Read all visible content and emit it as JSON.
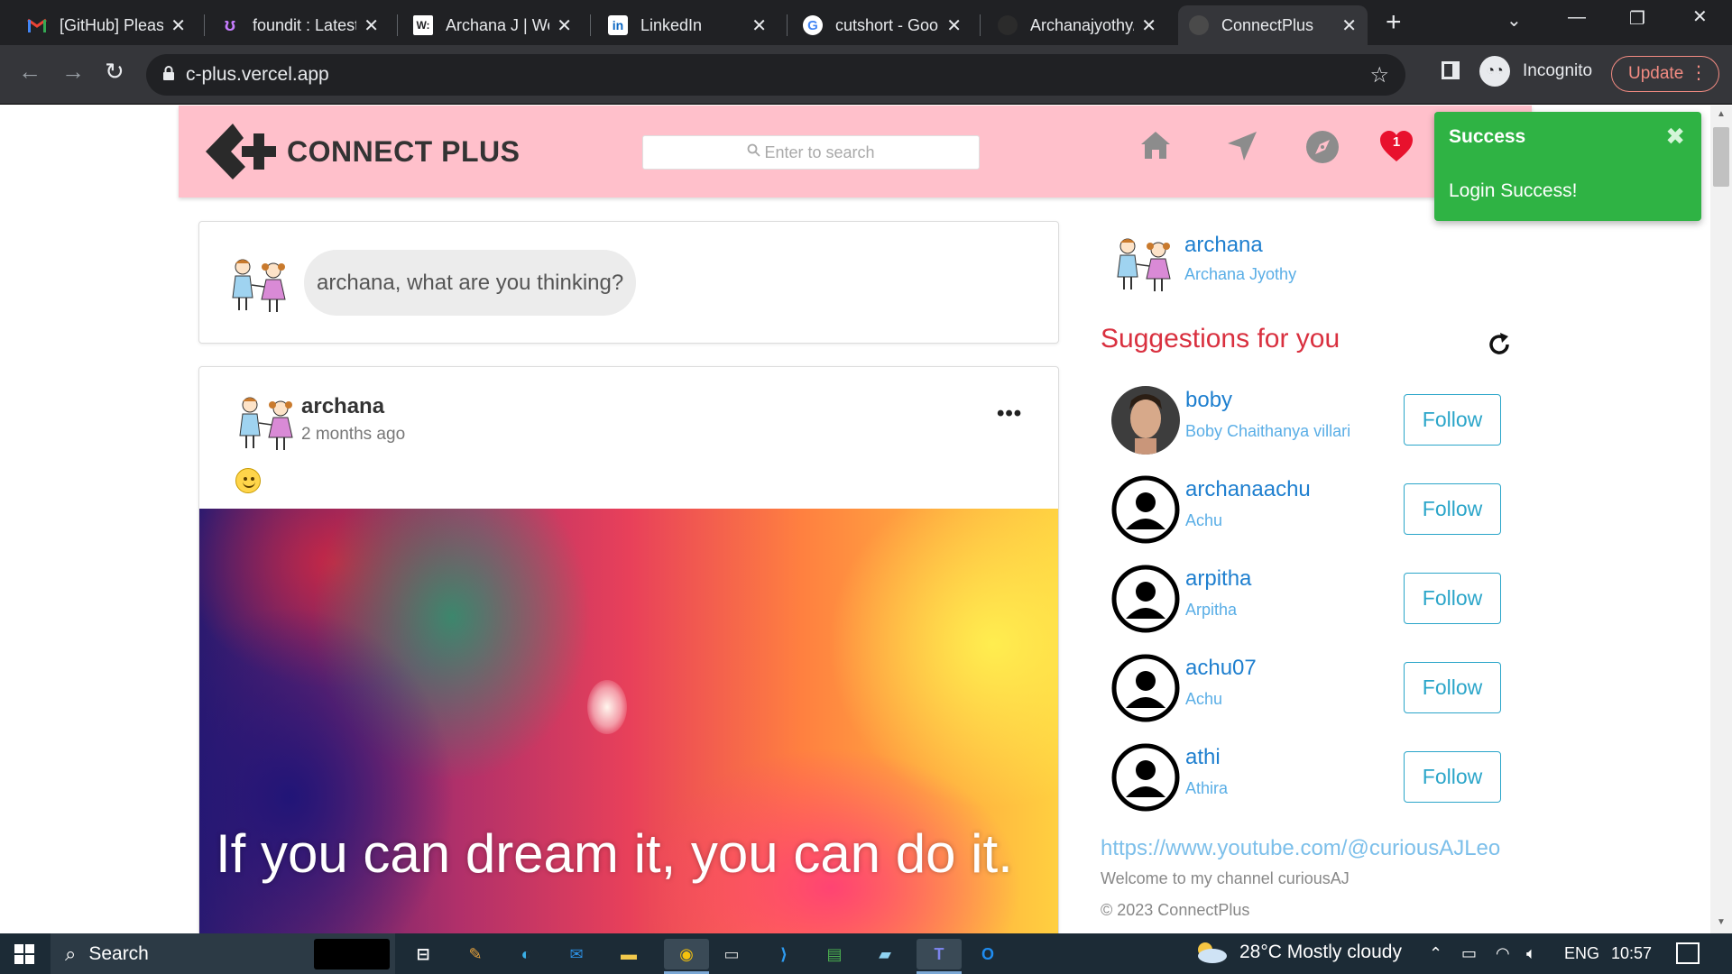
{
  "browser": {
    "tabs": [
      {
        "title": "[GitHub] Please",
        "icon": "gmail-icon",
        "close": "✕"
      },
      {
        "title": "foundit : Latest",
        "icon": "foundit-icon",
        "close": "✕"
      },
      {
        "title": "Archana J | We",
        "icon": "w-icon",
        "close": "✕"
      },
      {
        "title": "LinkedIn",
        "icon": "linkedin-icon",
        "close": "✕"
      },
      {
        "title": "cutshort - Goo",
        "icon": "google-icon",
        "close": "✕"
      },
      {
        "title": "Archanajyothy/",
        "icon": "github-icon",
        "close": "✕"
      },
      {
        "title": "ConnectPlus",
        "icon": "page-icon",
        "close": "✕",
        "active": true
      }
    ],
    "url": "c-plus.vercel.app",
    "incognito_label": "Incognito",
    "update_label": "Update"
  },
  "header": {
    "logo_text": "CONNECT PLUS",
    "search_placeholder": "Enter to search",
    "notification_count": "1",
    "colors": {
      "background": "#ffc0cb",
      "heart": "#e8112d"
    }
  },
  "toast": {
    "title": "Success",
    "message": "Login Success!",
    "close": "✖",
    "color": "#2fb344"
  },
  "composer": {
    "prompt": "archana, what are you thinking?"
  },
  "post": {
    "username": "archana",
    "time": "2 months ago",
    "more": "•••",
    "image_text": "If you can dream it, you can do it."
  },
  "profile": {
    "username": "archana",
    "fullname": "Archana Jyothy"
  },
  "suggestions": {
    "title": "Suggestions for you",
    "items": [
      {
        "username": "boby",
        "fullname": "Boby Chaithanya villari",
        "button": "Follow",
        "avatar": "photo"
      },
      {
        "username": "archanaachu",
        "fullname": "Achu",
        "button": "Follow",
        "avatar": "default"
      },
      {
        "username": "arpitha",
        "fullname": "Arpitha",
        "button": "Follow",
        "avatar": "default"
      },
      {
        "username": "achu07",
        "fullname": "Achu",
        "button": "Follow",
        "avatar": "default"
      },
      {
        "username": "athi",
        "fullname": "Athira",
        "button": "Follow",
        "avatar": "default"
      }
    ]
  },
  "footer": {
    "link": "https://www.youtube.com/@curiousAJLeo",
    "description": "Welcome to my channel curiousAJ",
    "copyright": "© 2023 ConnectPlus"
  },
  "taskbar": {
    "search_label": "Search",
    "weather": "28°C  Mostly cloudy",
    "language": "ENG",
    "time": "10:57"
  }
}
